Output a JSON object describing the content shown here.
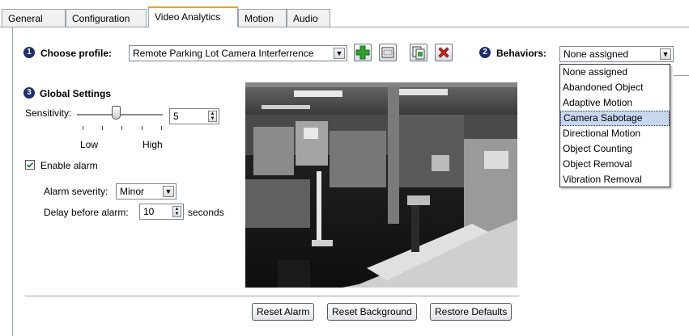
{
  "tabs": [
    {
      "label": "General"
    },
    {
      "label": "Configuration"
    },
    {
      "label": "Video Analytics"
    },
    {
      "label": "Motion"
    },
    {
      "label": "Audio"
    }
  ],
  "profile": {
    "step": "1",
    "label": "Choose profile:",
    "value": "Remote Parking Lot Camera Interferrence"
  },
  "behaviors": {
    "step": "2",
    "label": "Behaviors:",
    "value": "None assigned",
    "options": [
      "None assigned",
      "Abandoned Object",
      "Adaptive Motion",
      "Camera Sabotage",
      "Directional Motion",
      "Object Counting",
      "Object Removal",
      "Vibration Removal"
    ],
    "highlighted": "Camera Sabotage"
  },
  "global": {
    "step": "3",
    "title": "Global Settings",
    "sensitivity_label": "Sensitivity:",
    "sensitivity_value": "5",
    "low_label": "Low",
    "high_label": "High",
    "enable_alarm_label": "Enable alarm",
    "enable_alarm_checked": true,
    "severity_label": "Alarm severity:",
    "severity_value": "Minor",
    "delay_label": "Delay before alarm:",
    "delay_value": "10",
    "delay_unit": "seconds"
  },
  "buttons": {
    "reset_alarm": "Reset Alarm",
    "reset_background": "Reset Background",
    "restore_defaults": "Restore Defaults"
  },
  "colors": {
    "step_badge": "#1c2f6e",
    "active_tab_accent": "#f0a020",
    "add_icon": "#2fa12f",
    "delete_icon": "#d62020"
  }
}
